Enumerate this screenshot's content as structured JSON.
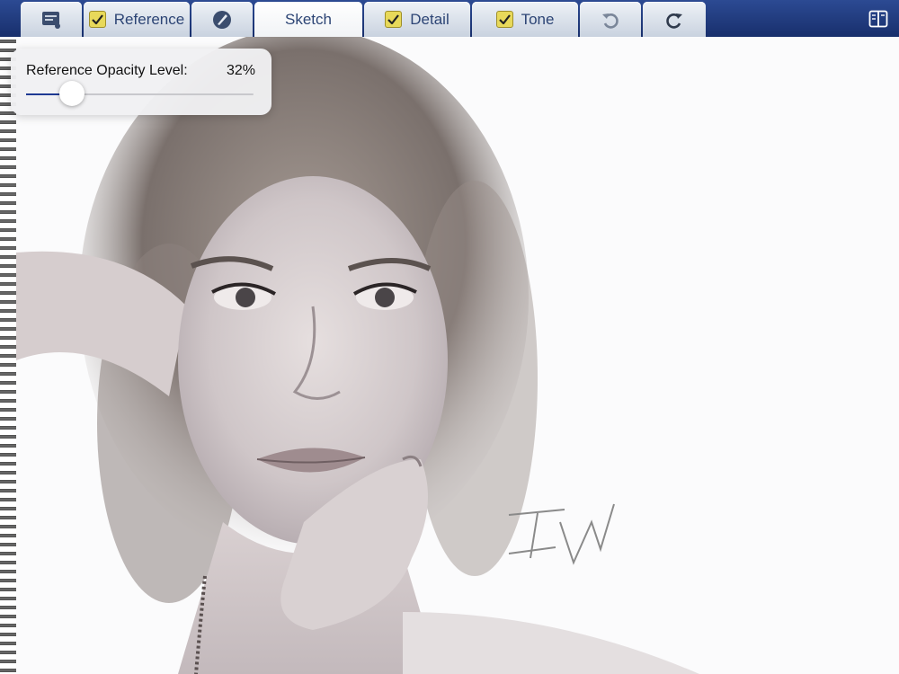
{
  "toolbar": {
    "tabs": {
      "reference": {
        "label": "Reference",
        "checked": true
      },
      "sketch": {
        "label": "Sketch",
        "active": true
      },
      "detail": {
        "label": "Detail",
        "checked": true
      },
      "tone": {
        "label": "Tone",
        "checked": true
      }
    },
    "icons": {
      "menu": "gallery-menu-icon",
      "reference_check": "checkmark-icon",
      "brush": "brush-palette-icon",
      "undo": "undo-icon",
      "redo": "redo-icon",
      "split_view": "split-view-icon"
    }
  },
  "reference_popover": {
    "label": "Reference Opacity Level:",
    "value_text": "32%",
    "opacity_level": 0.2
  },
  "canvas": {
    "content": "portrait-sketch-image"
  },
  "colors": {
    "toolbar_bg": "#1f3a7e",
    "checkbox": "#e8d95a",
    "slider_fill": "#1f3a93"
  }
}
